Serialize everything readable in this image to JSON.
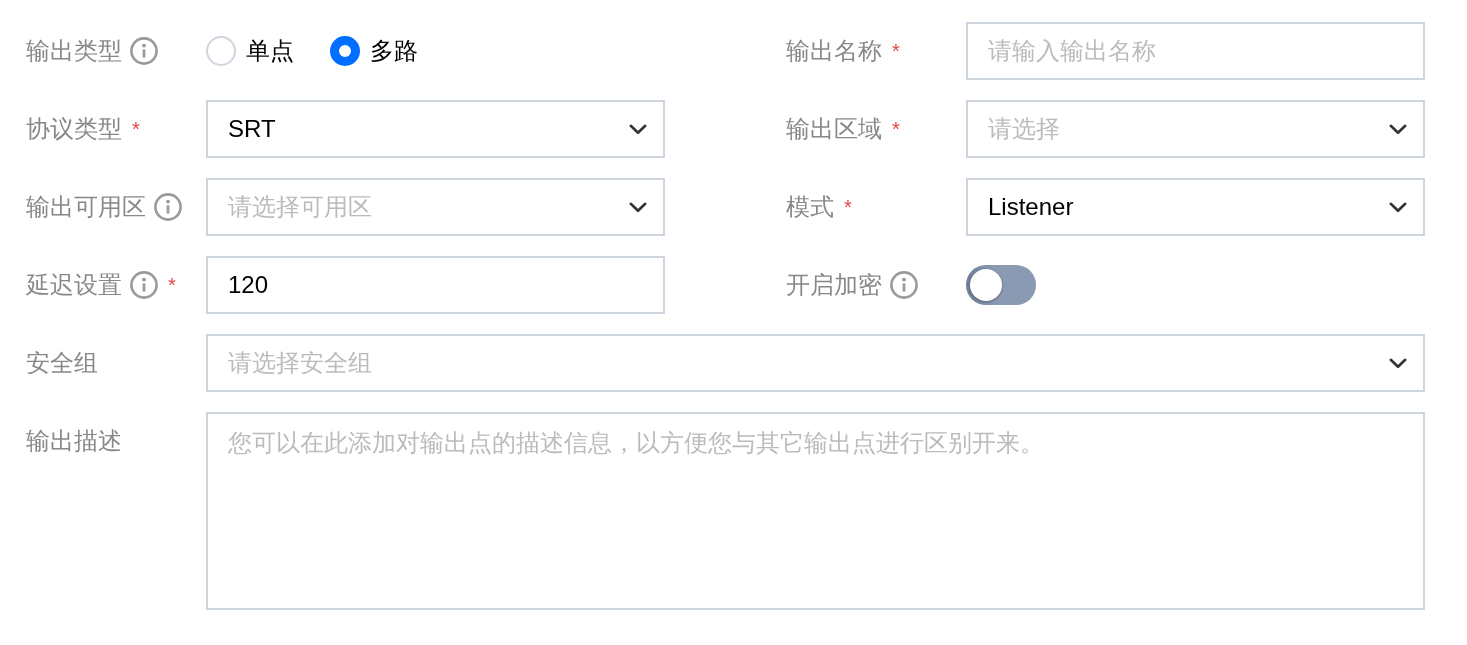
{
  "rows": [
    {
      "fields": [
        {
          "kind": "radio",
          "label": "输出类型",
          "info": true,
          "options": [
            {
              "label": "单点",
              "selected": false
            },
            {
              "label": "多路",
              "selected": true
            }
          ]
        },
        {
          "kind": "input",
          "label": "输出名称",
          "info": false,
          "required_mark": "*",
          "placeholder": "请输入输出名称"
        }
      ]
    },
    {
      "fields": [
        {
          "kind": "select",
          "label": "协议类型",
          "info": false,
          "required_mark": "*",
          "value": "SRT"
        },
        {
          "kind": "select",
          "label": "输出区域",
          "info": false,
          "required_mark": "*",
          "placeholder": "请选择"
        }
      ]
    },
    {
      "fields": [
        {
          "kind": "select",
          "label": "输出可用区",
          "info": true,
          "placeholder": "请选择可用区"
        },
        {
          "kind": "select",
          "label": "模式",
          "info": false,
          "required_mark": "*",
          "value": "Listener"
        }
      ]
    },
    {
      "fields": [
        {
          "kind": "input",
          "label": "延迟设置",
          "info": true,
          "required_mark": "*",
          "value": "120"
        },
        {
          "kind": "toggle",
          "label": "开启加密",
          "info": true,
          "on": false
        }
      ]
    },
    {
      "fields": [
        {
          "kind": "select",
          "label": "安全组",
          "info": false,
          "placeholder": "请选择安全组"
        }
      ]
    },
    {
      "fields": [
        {
          "kind": "textarea",
          "label": "输出描述",
          "info": false,
          "placeholder": "您可以在此添加对输出点的描述信息，以方便您与其它输出点进行区别开来。"
        }
      ]
    }
  ]
}
